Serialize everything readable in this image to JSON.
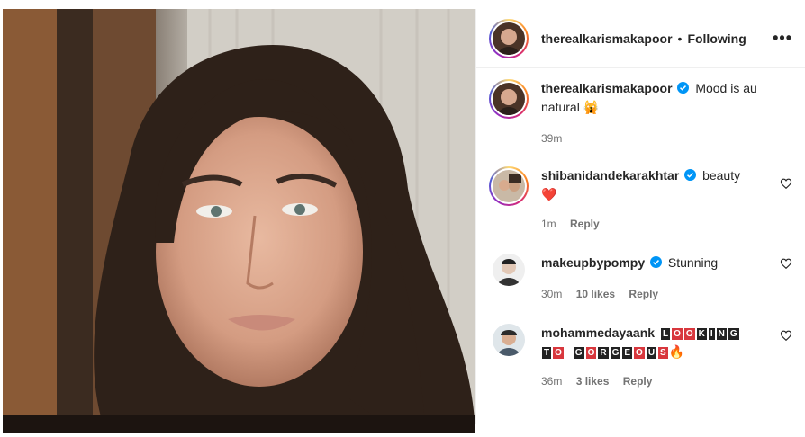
{
  "post": {
    "author": "therealkarismakapoor",
    "dot": "•",
    "follow_status": "Following",
    "more": "•••"
  },
  "caption": {
    "username": "therealkarismakapoor",
    "text": "Mood is au natural",
    "emoji": "🙀",
    "time": "39m"
  },
  "comments": [
    {
      "username": "shibanidandekarakhtar",
      "text": "beauty",
      "emoji": "❤️",
      "time": "1m",
      "likes": "",
      "reply": "Reply"
    },
    {
      "username": "makeupbypompy",
      "text": "Stunning",
      "time": "30m",
      "likes": "10 likes",
      "reply": "Reply"
    },
    {
      "username": "mohammedayaank",
      "text_blocks_line1": [
        "L",
        "O",
        "O",
        "K",
        "I",
        "N",
        "G"
      ],
      "text_blocks_line2": [
        "T",
        "O",
        "G",
        "O",
        "R",
        "G",
        "E",
        "O",
        "U",
        "S"
      ],
      "emoji": "🔥",
      "time": "36m",
      "likes": "3 likes",
      "reply": "Reply"
    }
  ],
  "colors": {
    "text": "#262626",
    "secondary": "#737373",
    "verified": "#0095f6",
    "heart": "#ed4956"
  },
  "icons": [
    "verified-badge-icon",
    "heart-icon",
    "more-options-icon"
  ]
}
